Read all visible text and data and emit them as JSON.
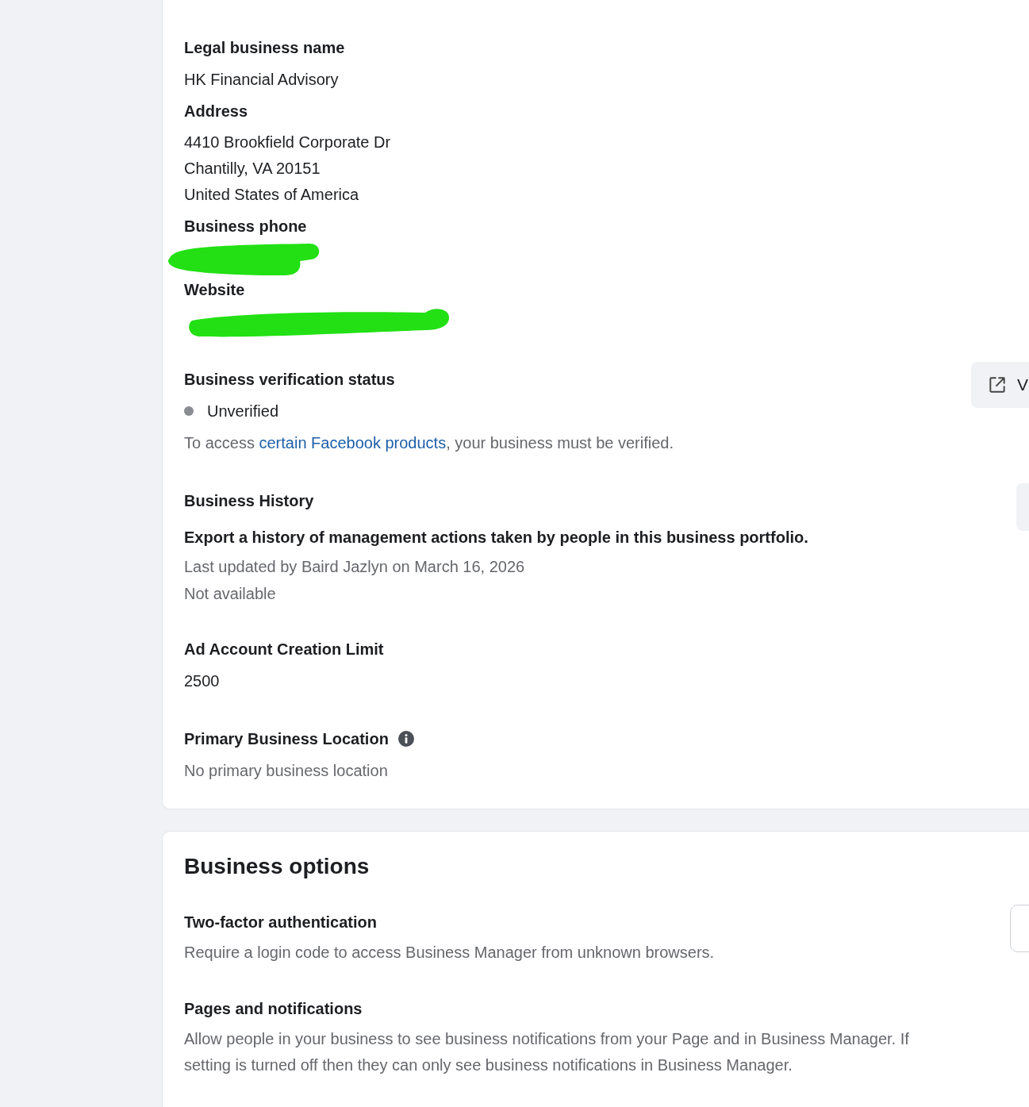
{
  "details_card": {
    "legal_name": {
      "label": "Legal business name",
      "value": "HK Financial Advisory"
    },
    "address": {
      "label": "Address",
      "lines": [
        "4410 Brookfield Corporate Dr",
        "Chantilly, VA 20151",
        "United States of America"
      ]
    },
    "phone": {
      "label": "Business phone",
      "redacted": true
    },
    "website": {
      "label": "Website",
      "redacted": true
    },
    "verification": {
      "label": "Business verification status",
      "status": "Unverified",
      "note_before": "To access ",
      "note_link": "certain Facebook products",
      "note_after": ", your business must be verified.",
      "button": "V"
    },
    "history": {
      "label": "Business History",
      "title": "Export a history of management actions taken by people in this business portfolio.",
      "updated": "Last updated by Baird Jazlyn on March 16, 2026",
      "availability": "Not available"
    },
    "ad_limit": {
      "label": "Ad Account Creation Limit",
      "value": "2500"
    },
    "primary_location": {
      "label": "Primary Business Location",
      "value": "No primary business location"
    }
  },
  "options_card": {
    "title": "Business options",
    "items": [
      {
        "title": "Two-factor authentication",
        "lines": [
          "Require a login code to access Business Manager from unknown browsers."
        ]
      },
      {
        "title": "Pages and notifications",
        "lines": [
          "Allow people in your business to see business notifications from your Page and in Business Manager. If",
          "setting is turned off then they can only see business notifications in Business Manager."
        ]
      }
    ]
  }
}
